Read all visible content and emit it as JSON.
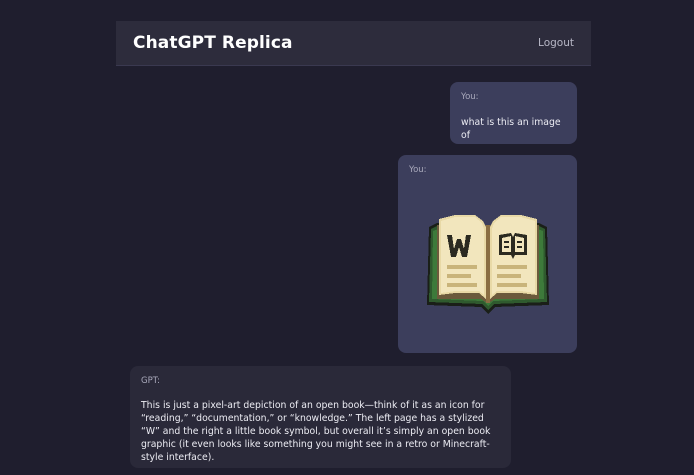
{
  "header": {
    "title": "ChatGPT Replica",
    "logout_label": "Logout"
  },
  "messages": [
    {
      "sender": "You:",
      "text": "what is this an image of"
    },
    {
      "sender": "You:",
      "image_icon": "open-book-pixel-art-icon"
    },
    {
      "sender": "GPT:",
      "text": "This is just a pixel-art depiction of an open book—think of it as an icon for “reading,” “documentation,” or “knowledge.” The left page has a stylized “W” and the right a little book symbol, but overall it’s simply an open book graphic (it even looks like something you might see in a retro or Minecraft-style interface)."
    }
  ],
  "colors": {
    "background": "#1f1e2e",
    "header": "#2d2c3c",
    "user_bubble": "#3c3e5c",
    "gpt_bubble": "#2a2939",
    "book_cover": "#2f5a2e",
    "book_page": "#e8d9a6"
  }
}
